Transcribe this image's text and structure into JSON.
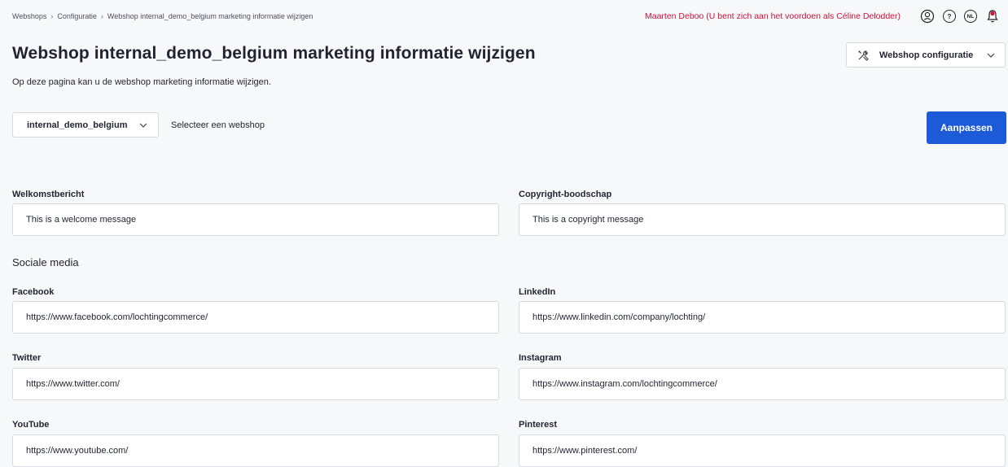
{
  "breadcrumb": [
    "Webshops",
    "Configuratie",
    "Webshop internal_demo_belgium marketing informatie wijzigen"
  ],
  "breadcrumb_separator": "›",
  "header": {
    "user_text": "Maarten Deboo (U bent zich aan het voordoen als Céline Delodder)",
    "help_icon": "?",
    "language": "NL"
  },
  "page": {
    "title": "Webshop internal_demo_belgium marketing informatie wijzigen",
    "subtitle": "Op deze pagina kan u de webshop marketing informatie wijzigen."
  },
  "config_menu": {
    "label": "Webshop configuratie"
  },
  "webshop_select": {
    "value": "internal_demo_belgium",
    "hint": "Selecteer een webshop"
  },
  "actions": {
    "submit_label": "Aanpassen"
  },
  "fields": {
    "welcome": {
      "label": "Welkomstbericht",
      "value": "This is a welcome message"
    },
    "copyright": {
      "label": "Copyright-boodschap",
      "value": "This is a copyright message"
    }
  },
  "social": {
    "title": "Sociale media",
    "facebook": {
      "label": "Facebook",
      "value": "https://www.facebook.com/lochtingcommerce/"
    },
    "linkedin": {
      "label": "LinkedIn",
      "value": "https://www.linkedin.com/company/lochting/"
    },
    "twitter": {
      "label": "Twitter",
      "value": "https://www.twitter.com/"
    },
    "instagram": {
      "label": "Instagram",
      "value": "https://www.instagram.com/lochtingcommerce/"
    },
    "youtube": {
      "label": "YouTube",
      "value": "https://www.youtube.com/"
    },
    "pinterest": {
      "label": "Pinterest",
      "value": "https://www.pinterest.com/"
    }
  },
  "colors": {
    "accent": "#1d5ad8",
    "user_text": "#d0103a",
    "notification": "#d0103a"
  }
}
